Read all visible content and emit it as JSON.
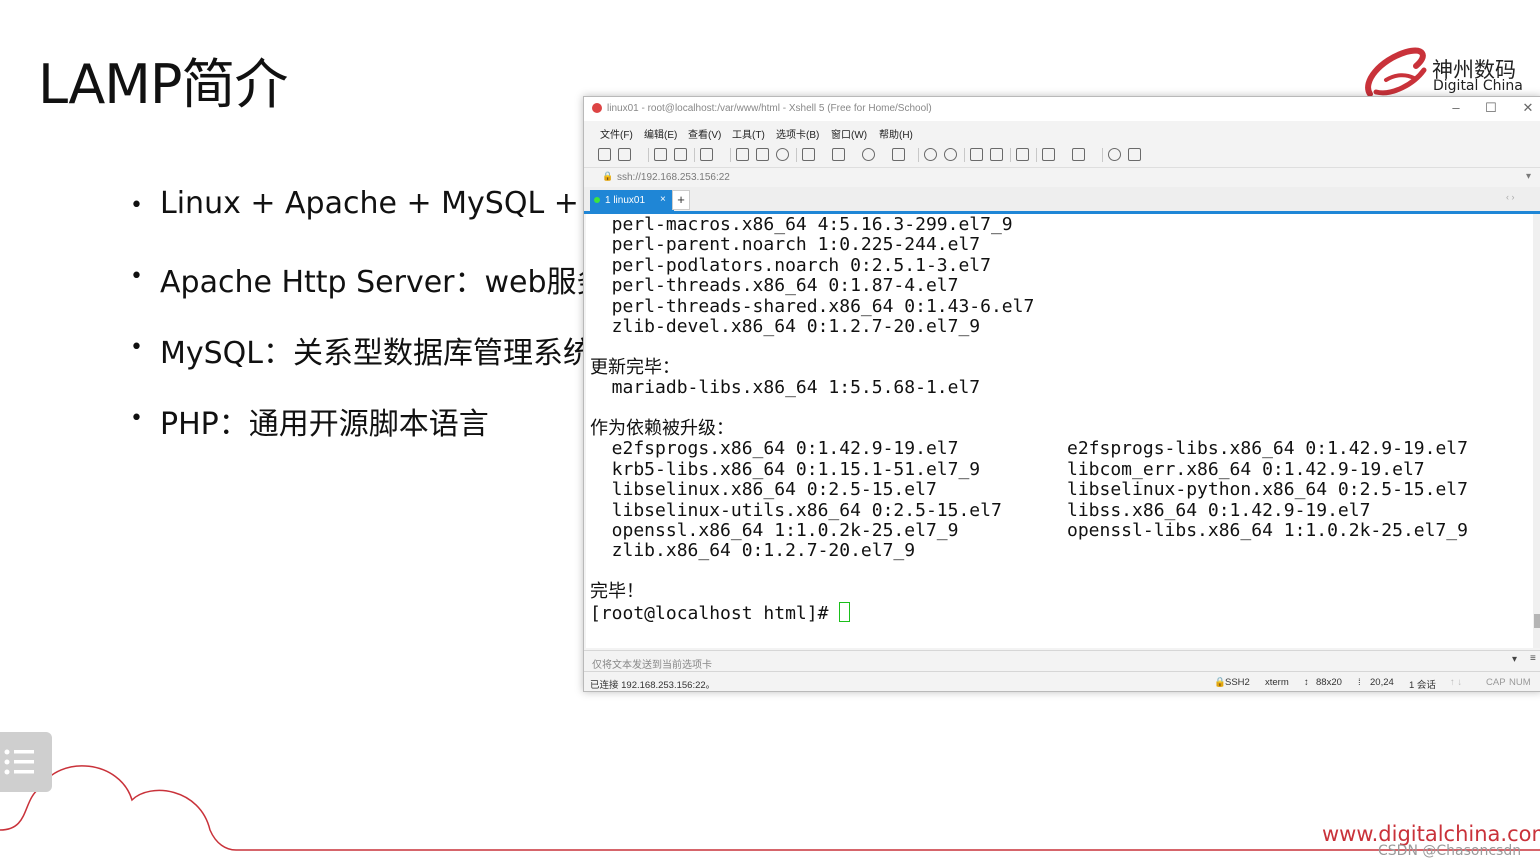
{
  "slide": {
    "title": "LAMP简介",
    "bullets": [
      "Linux + Apache + MySQL + PHP",
      "Apache Http Server：web服务器",
      "MySQL：关系型数据库管理系统",
      "PHP：通用开源脚本语言"
    ],
    "logo_cn": "神州数码",
    "logo_en": "Digital China",
    "footer_url": "www.digitalchina.com",
    "watermark": "CSDN @Chasoncsdn",
    "accent_color": "#c9323a"
  },
  "xshell": {
    "title": "linux01 - root@localhost:/var/www/html - Xshell 5 (Free for Home/School)",
    "menu": [
      "文件(F)",
      "编辑(E)",
      "查看(V)",
      "工具(T)",
      "选项卡(B)",
      "窗口(W)",
      "帮助(H)"
    ],
    "address": "ssh://192.168.253.156:22",
    "tab_label": "1 linux01",
    "tab_color": "#1f86d6",
    "terminal": {
      "lines": [
        "  perl-macros.x86_64 4:5.16.3-299.el7_9",
        "  perl-parent.noarch 1:0.225-244.el7",
        "  perl-podlators.noarch 0:2.5.1-3.el7",
        "  perl-threads.x86_64 0:1.87-4.el7",
        "  perl-threads-shared.x86_64 0:1.43-6.el7",
        "  zlib-devel.x86_64 0:1.2.7-20.el7_9",
        "",
        "更新完毕：",
        "  mariadb-libs.x86_64 1:5.5.68-1.el7",
        "",
        "作为依赖被升级：",
        "  e2fsprogs.x86_64 0:1.42.9-19.el7",
        "  krb5-libs.x86_64 0:1.15.1-51.el7_9",
        "  libselinux.x86_64 0:2.5-15.el7",
        "  libselinux-utils.x86_64 0:2.5-15.el7",
        "  openssl.x86_64 1:1.0.2k-25.el7_9",
        "  zlib.x86_64 0:1.2.7-20.el7_9",
        "",
        "完毕！",
        "[root@localhost html]# "
      ],
      "right_column": [
        "e2fsprogs-libs.x86_64 0:1.42.9-19.el7",
        "libcom_err.x86_64 0:1.42.9-19.el7",
        "libselinux-python.x86_64 0:2.5-15.el7",
        "libss.x86_64 0:1.42.9-19.el7",
        "openssl-libs.x86_64 1:1.0.2k-25.el7_9"
      ]
    },
    "send_bar": "仅将文本发送到当前选项卡",
    "status": {
      "connection": "已连接 192.168.253.156:22。",
      "protocol": "SSH2",
      "term": "xterm",
      "size": "88x20",
      "cursor_pos": "20,24",
      "sessions": "1 会话",
      "caps": "CAP",
      "num": "NUM"
    }
  }
}
